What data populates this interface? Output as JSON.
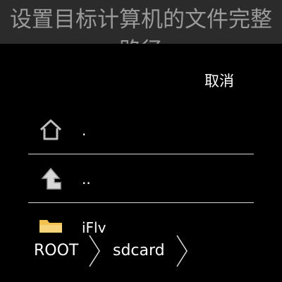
{
  "dialog": {
    "title": "设置目标计算机的文件完整路径",
    "cancel_label": "取消"
  },
  "files": [
    {
      "label": ".",
      "icon": "home-icon"
    },
    {
      "label": "..",
      "icon": "up-arrow-icon"
    },
    {
      "label": "iFly",
      "icon": "folder-icon"
    }
  ],
  "breadcrumb": [
    {
      "label": "ROOT"
    },
    {
      "label": "sdcard"
    }
  ],
  "colors": {
    "background": "#000000",
    "title_bar": "#2b2b2b",
    "title_text": "#9a9a9a",
    "text": "#ffffff",
    "divider": "#d9d9d9",
    "folder": "#f2c14e"
  }
}
